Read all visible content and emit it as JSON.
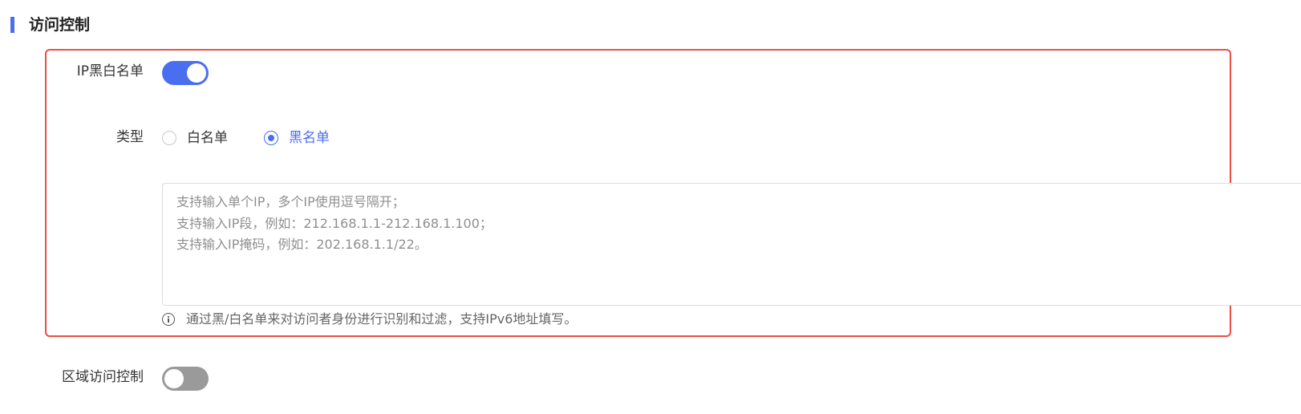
{
  "section": {
    "title": "访问控制"
  },
  "ip_list": {
    "label": "IP黑白名单",
    "enabled": true,
    "type_label": "类型",
    "options": [
      {
        "label": "白名单",
        "checked": false
      },
      {
        "label": "黑名单",
        "checked": true
      }
    ],
    "textarea": {
      "value": "",
      "placeholder": "支持输入单个IP，多个IP使用逗号隔开；\n支持输入IP段，例如：212.168.1.1-212.168.1.100；\n支持输入IP掩码，例如：202.168.1.1/22。"
    },
    "hint": "通过黑/白名单来对访问者身份进行识别和过滤，支持IPv6地址填写。"
  },
  "region_control": {
    "label": "区域访问控制",
    "enabled": false
  },
  "colors": {
    "accent": "#4a6ef0",
    "highlight_border": "#ea4f44",
    "switch_off": "#9a9a9a"
  }
}
